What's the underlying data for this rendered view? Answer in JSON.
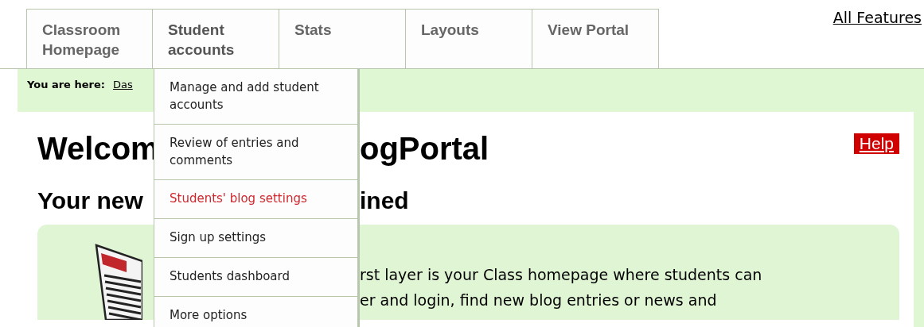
{
  "tabs": [
    {
      "label": "Classroom Homepage",
      "selected": false
    },
    {
      "label": "Student accounts",
      "selected": true
    },
    {
      "label": "Stats",
      "selected": false
    },
    {
      "label": "Layouts",
      "selected": false
    },
    {
      "label": "View Portal",
      "selected": false
    }
  ],
  "all_features": "All Features",
  "breadcrumb": {
    "label": "You are here:",
    "link": "Das"
  },
  "dropdown": [
    {
      "label": "Manage and add student accounts",
      "selected": false
    },
    {
      "label": "Review of entries and comments",
      "selected": false
    },
    {
      "label": "Students' blog settings",
      "selected": true
    },
    {
      "label": "Sign up settings",
      "selected": false
    },
    {
      "label": "Students dashboard",
      "selected": false
    },
    {
      "label": "More options",
      "selected": false
    }
  ],
  "heading": {
    "left": "Welcom",
    "right": "ogPortal"
  },
  "help": "Help",
  "subheading": {
    "left": "Your new",
    "right": "ined"
  },
  "intro_lines": [
    "rst layer is your Class homepage where students can",
    "er and login, find new blog entries or news and"
  ]
}
